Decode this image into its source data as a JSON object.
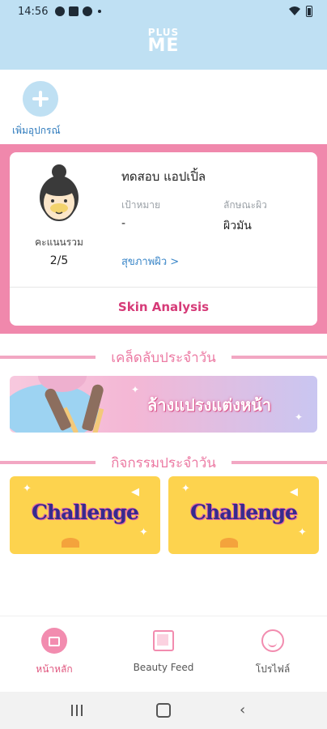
{
  "status_bar": {
    "time": "14:56"
  },
  "header": {
    "logo_line1": "PLUS",
    "logo_line2": "ME"
  },
  "add_device": {
    "label": "เพิ่มอุปกรณ์"
  },
  "profile_card": {
    "name": "ทดสอบ แอปเปิ้ล",
    "score_label": "คะแนนรวม",
    "score_value": "2/5",
    "goal_label": "เป้าหมาย",
    "goal_value": "-",
    "skin_type_label": "ลักษณะผิว",
    "skin_type_value": "ผิวมัน",
    "skin_health_link": "สุขภาพผิว >",
    "analysis_button": "Skin Analysis"
  },
  "daily_tips": {
    "title": "เคล็ดลับประจำวัน",
    "banner_text": "ล้างแปรงแต่งหน้า"
  },
  "daily_activities": {
    "title": "กิจกรรมประจำวัน",
    "cards": [
      {
        "label": "Challenge"
      },
      {
        "label": "Challenge"
      }
    ]
  },
  "bottom_nav": {
    "items": [
      {
        "label": "หน้าหลัก",
        "icon": "home-icon",
        "active": true
      },
      {
        "label": "Beauty Feed",
        "icon": "feed-icon",
        "active": false
      },
      {
        "label": "โปรไฟล์",
        "icon": "profile-icon",
        "active": false
      }
    ]
  },
  "colors": {
    "header_bg": "#bfe0f3",
    "accent_pink": "#f088ac",
    "link_blue": "#3a86c8",
    "challenge_yellow": "#fdd34e"
  }
}
